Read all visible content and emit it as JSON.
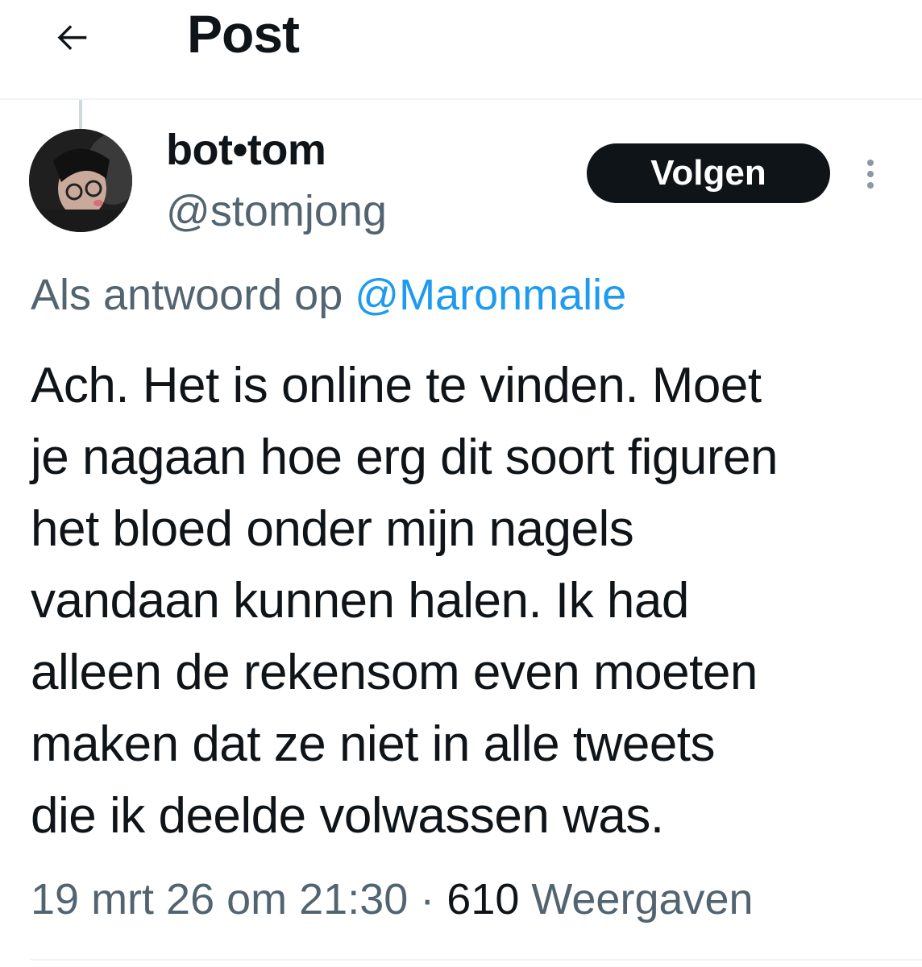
{
  "header": {
    "back_icon": "arrow-left-icon",
    "title": "Post"
  },
  "author": {
    "display_name": "bot•tom",
    "handle": "@stomjong",
    "avatar_icon": "profile-photo"
  },
  "actions": {
    "follow_label": "Volgen",
    "more_icon": "more-vertical-icon"
  },
  "reply_context": {
    "prefix": "Als antwoord op",
    "mention": "@Maronmalie"
  },
  "tweet": {
    "lines": [
      "Ach. Het is online te vinden. Moet",
      "je nagaan hoe erg dit soort figuren",
      "het bloed onder mijn nagels",
      "vandaan kunnen halen. Ik had",
      "alleen de rekensom even moeten",
      "maken dat ze niet in alle tweets",
      "die ik deelde volwassen was."
    ]
  },
  "meta": {
    "timestamp": "19 mrt 26 om 21:30",
    "separator": "·",
    "views_count": "610",
    "views_label": "Weergaven"
  },
  "colors": {
    "text": "#0f1419",
    "secondary": "#536471",
    "link": "#1d9bf0",
    "follow_bg": "#0f1419",
    "divider": "#eff3f4"
  }
}
